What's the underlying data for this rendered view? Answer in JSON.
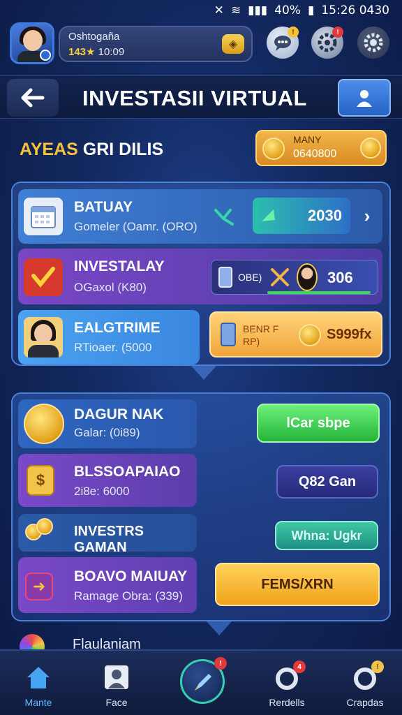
{
  "status_bar": {
    "time": "15:26 0430",
    "battery": "40%"
  },
  "profile": {
    "name": "Oshtogaña",
    "level": "143★",
    "time": "10:09",
    "notif_badge_1": "!",
    "notif_badge_2": "!"
  },
  "header": {
    "title": "INVESTASII VIRTUAL"
  },
  "section": {
    "title_accent": "AYEAS",
    "title_rest": " GRI DILIS",
    "balance_label": "MANY",
    "balance_value": "0640800"
  },
  "top_panel": {
    "rows": [
      {
        "title": "BATUAY",
        "subtitle": "Gomeler (Oamr. (ORO)",
        "value": "2030"
      },
      {
        "title": "INVESTALAY",
        "subtitle": "OGaxol (K80)",
        "tag": "OBE)",
        "value": "306"
      },
      {
        "title": "EALGTRIME",
        "subtitle": "RTioaer. (5000",
        "tag": "BENR F RP)",
        "value": "S999fx"
      }
    ]
  },
  "bottom_panel": {
    "rows": [
      {
        "title": "DAGUR NAK",
        "subtitle": "Galar: (0i89)",
        "button": "lCar sbpe"
      },
      {
        "title": "BLSSOAPAIAO",
        "subtitle": "2i8e: 6000",
        "button": "Q82 Gan"
      },
      {
        "title": "INVESTRS GAMAN",
        "subtitle": "",
        "button": "Whna: Ugkr"
      },
      {
        "title": "BOAVO MAIUAY",
        "subtitle": "Ramage Obra: (339)",
        "button": "FEMS/XRN"
      }
    ],
    "peek_label": "Flaulaniam"
  },
  "nav": {
    "items": [
      {
        "label": "Mante"
      },
      {
        "label": "Face"
      },
      {
        "label": ""
      },
      {
        "label": "Rerdells"
      },
      {
        "label": "Crapdas"
      }
    ],
    "badges": [
      "!",
      "4",
      "!"
    ]
  },
  "colors": {
    "background": "#12285e",
    "accent_gold": "#f7c23b",
    "green_button": "#3cd94e",
    "orange_button": "#f5a521",
    "purple_row": "#6a3fb4",
    "blue_row": "#3e8ae6"
  }
}
